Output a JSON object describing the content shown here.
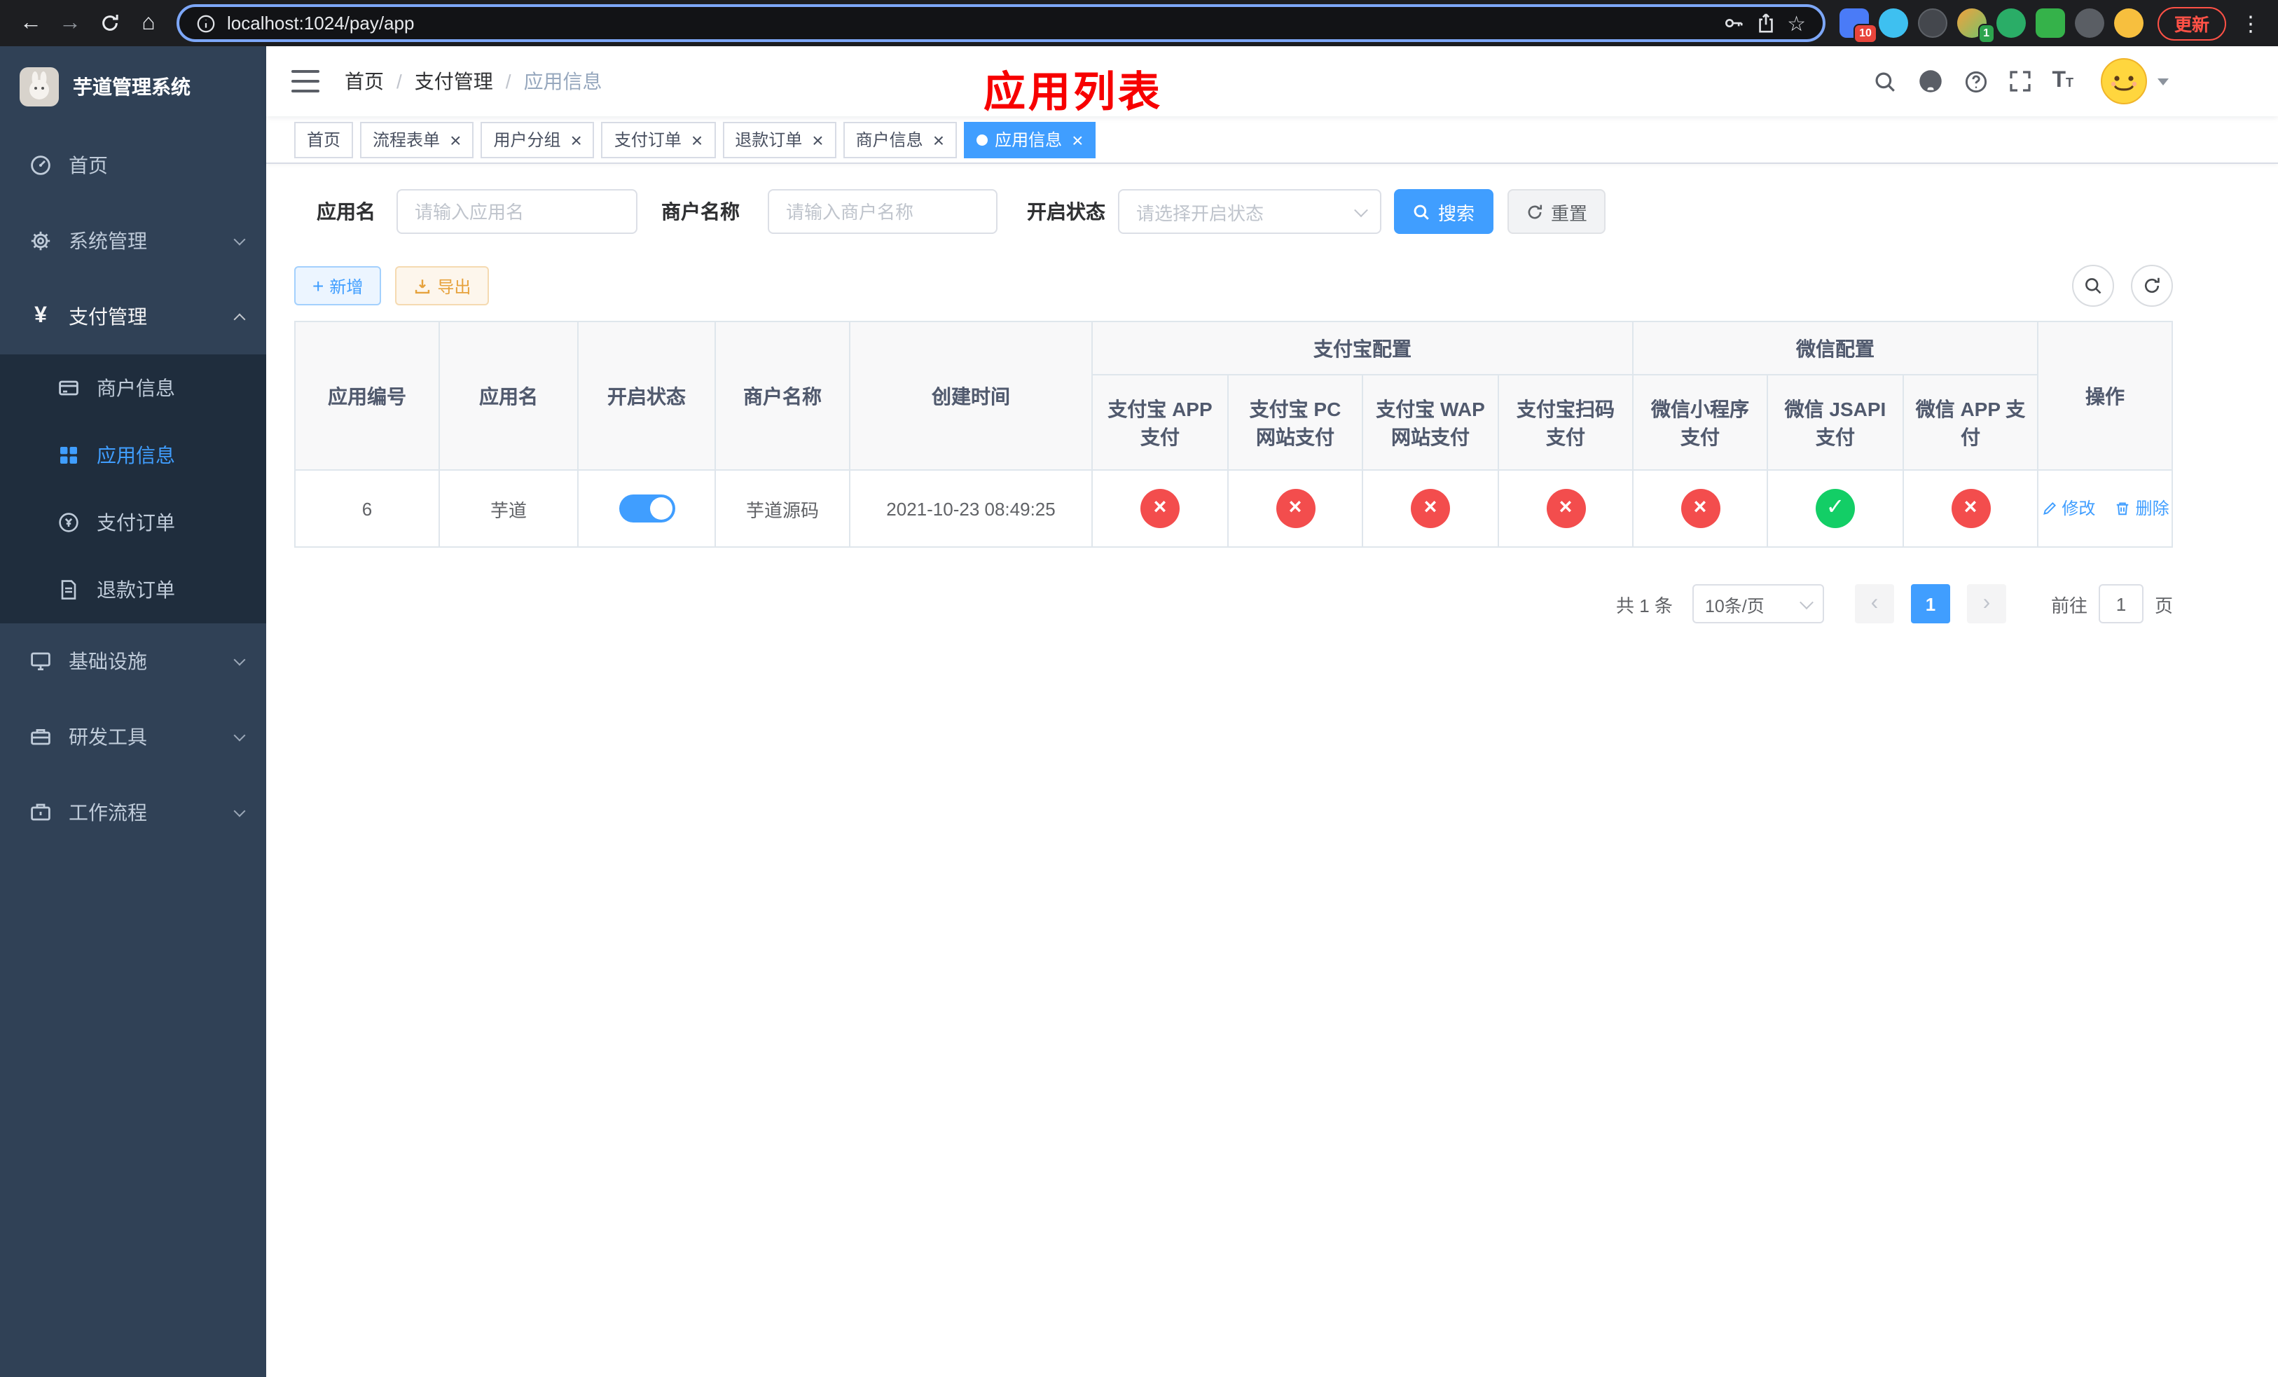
{
  "browser": {
    "url": "localhost:1024/pay/app",
    "update_label": "更新",
    "ext_badge_1": "10",
    "ext_badge_2": "1"
  },
  "icons": {
    "back": "←",
    "forward": "→",
    "home": "⌂",
    "star": "☆",
    "kebab": "⋮",
    "close": "×",
    "check": "✓",
    "cross": "×",
    "plus": "+",
    "yen": "¥",
    "prev": "‹",
    "next": "›",
    "font_large": "T",
    "font_small": "T"
  },
  "sidebar": {
    "title": "芋道管理系统",
    "items": {
      "home": "首页",
      "system": "系统管理",
      "payment": "支付管理",
      "infra": "基础设施",
      "devtools": "研发工具",
      "workflow": "工作流程"
    },
    "payment_children": {
      "merchant": "商户信息",
      "app": "应用信息",
      "order": "支付订单",
      "refund": "退款订单"
    }
  },
  "header": {
    "breadcrumb": [
      "首页",
      "支付管理",
      "应用信息"
    ],
    "separator": "/",
    "annotation": "应用列表"
  },
  "tabs": [
    {
      "label": "首页"
    },
    {
      "label": "流程表单"
    },
    {
      "label": "用户分组"
    },
    {
      "label": "支付订单"
    },
    {
      "label": "退款订单"
    },
    {
      "label": "商户信息"
    },
    {
      "label": "应用信息"
    }
  ],
  "filters": {
    "app_name_label": "应用名",
    "app_name_placeholder": "请输入应用名",
    "merchant_label": "商户名称",
    "merchant_placeholder": "请输入商户名称",
    "status_label": "开启状态",
    "status_placeholder": "请选择开启状态",
    "search_button": "搜索",
    "reset_button": "重置"
  },
  "toolbar": {
    "add_button": "新增",
    "export_button": "导出"
  },
  "table": {
    "col_app_id": "应用编号",
    "col_app_name": "应用名",
    "col_status": "开启状态",
    "col_merchant": "商户名称",
    "col_created": "创建时间",
    "group_alipay": "支付宝配置",
    "group_wechat": "微信配置",
    "col_alipay_app": "支付宝 APP 支付",
    "col_alipay_pc": "支付宝 PC 网站支付",
    "col_alipay_wap": "支付宝 WAP 网站支付",
    "col_alipay_qr": "支付宝扫码支付",
    "col_wx_mini": "微信小程序支付",
    "col_wx_jsapi": "微信 JSAPI 支付",
    "col_wx_app": "微信 APP 支付",
    "col_ops": "操作",
    "row": {
      "id": "6",
      "name": "芋道",
      "status_on": true,
      "merchant": "芋道源码",
      "created": "2021-10-23 08:49:25",
      "channels": [
        "no",
        "no",
        "no",
        "no",
        "no",
        "yes",
        "no"
      ],
      "edit_label": "修改",
      "delete_label": "删除"
    }
  },
  "pagination": {
    "total": "共 1 条",
    "page_size": "10条/页",
    "page": "1",
    "goto_label": "前往",
    "goto_value": "1",
    "page_unit": "页"
  }
}
